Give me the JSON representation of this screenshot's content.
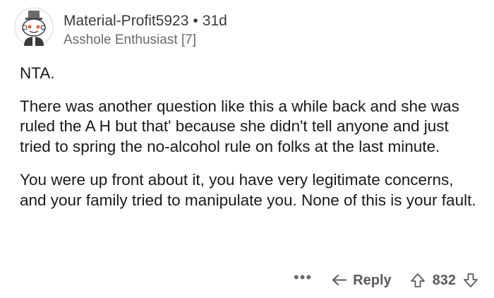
{
  "comment": {
    "author": "Material-Profit5923",
    "separator": "•",
    "age": "31d",
    "flair": "Asshole Enthusiast [7]",
    "paragraphs": [
      "NTA.",
      "There was another question like this a while back and she was ruled the A H but that' because she didn't tell anyone and just tried to spring the no-alcohol rule on folks at the last minute.",
      "You were up front about it, you have very legitimate concerns, and your family tried to manipulate you. None of this is your fault."
    ]
  },
  "actions": {
    "more": "•••",
    "reply_label": "Reply",
    "score": "832",
    "icons": [
      "reply-arrow-icon",
      "upvote-icon",
      "downvote-icon",
      "more-options-icon"
    ]
  },
  "avatar": {
    "icon": "snoo-avatar-icon"
  }
}
